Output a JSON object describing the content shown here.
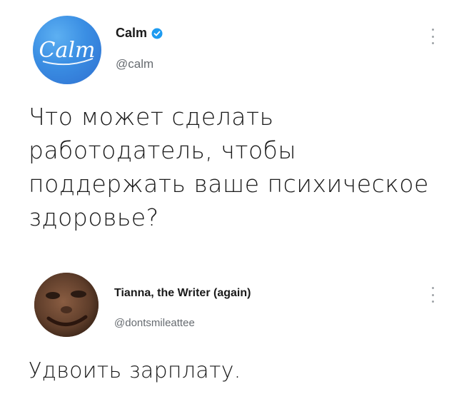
{
  "tweets": [
    {
      "display_name": "Calm",
      "verified": true,
      "handle": "@calm",
      "avatar_text": "Calm",
      "text": "Что может сделать работодатель, чтобы поддержать ваше психическое здоровье?"
    },
    {
      "display_name": "Tianna, the Writer (again)",
      "verified": false,
      "handle": "@dontsmileattee",
      "text": "Удвоить зарплату."
    }
  ],
  "colors": {
    "calm_blue": "#3a8ee3",
    "verified_blue": "#1d9bf0",
    "handle_gray": "#666b70",
    "text": "#1b1b1b"
  },
  "icons": {
    "verified": "verified-badge-icon",
    "more": "more-options-icon"
  }
}
